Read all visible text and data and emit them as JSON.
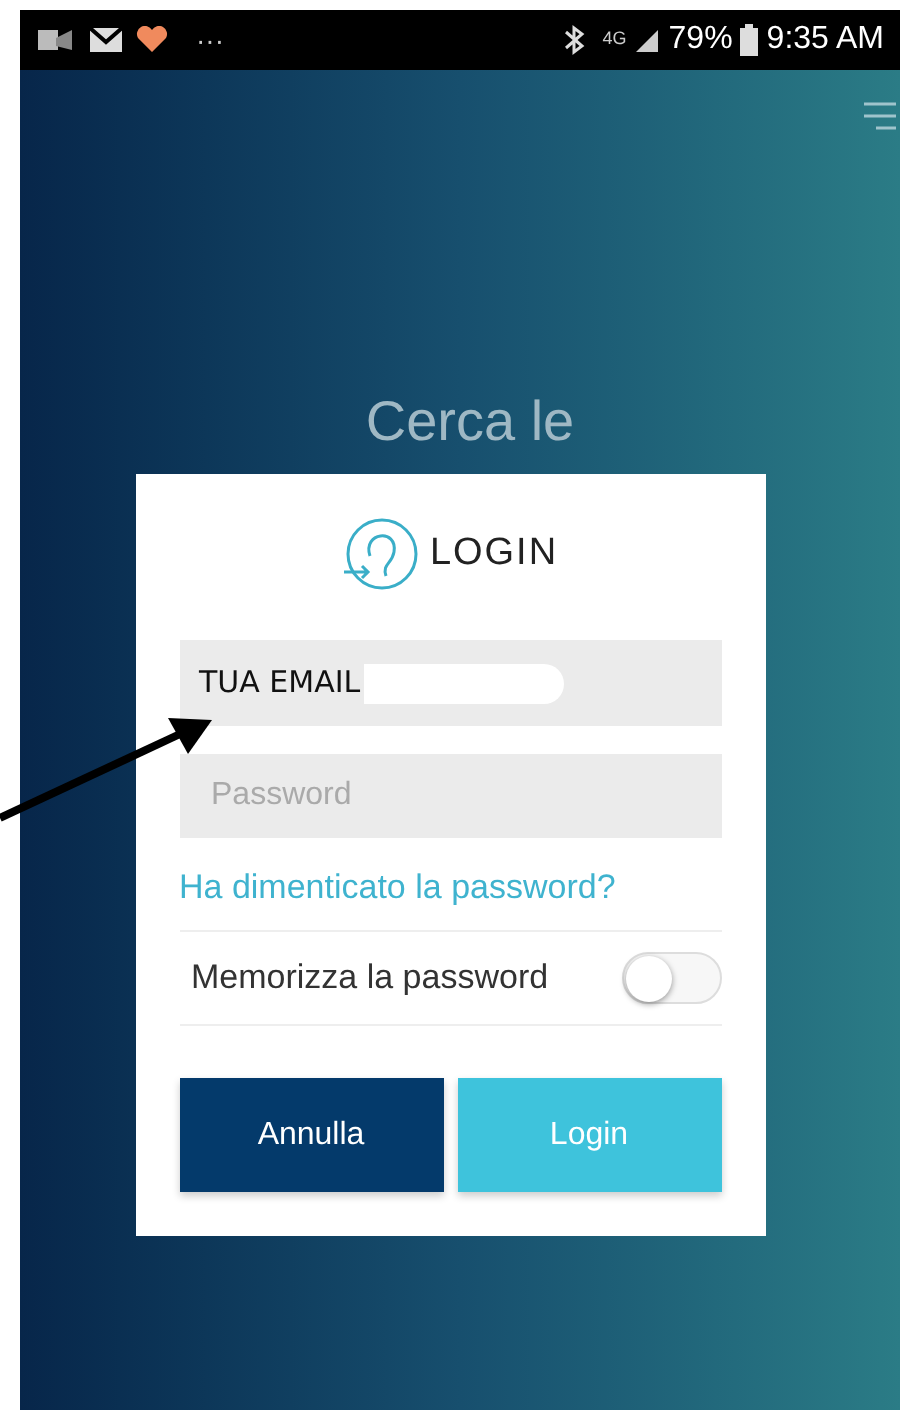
{
  "status_bar": {
    "overflow": "···",
    "network": "4G",
    "battery": "79%",
    "time": "9:35 AM"
  },
  "title": "Cerca le",
  "login": {
    "heading": "LOGIN",
    "email": {
      "value": "TUA EMAIL"
    },
    "password": {
      "placeholder": "Password"
    },
    "forgot_link": "Ha dimenticato la password?",
    "remember": {
      "label": "Memorizza la password",
      "on": false
    },
    "buttons": [
      {
        "label": "Annulla",
        "kind": "secondary"
      },
      {
        "label": "Login",
        "kind": "primary"
      }
    ]
  }
}
